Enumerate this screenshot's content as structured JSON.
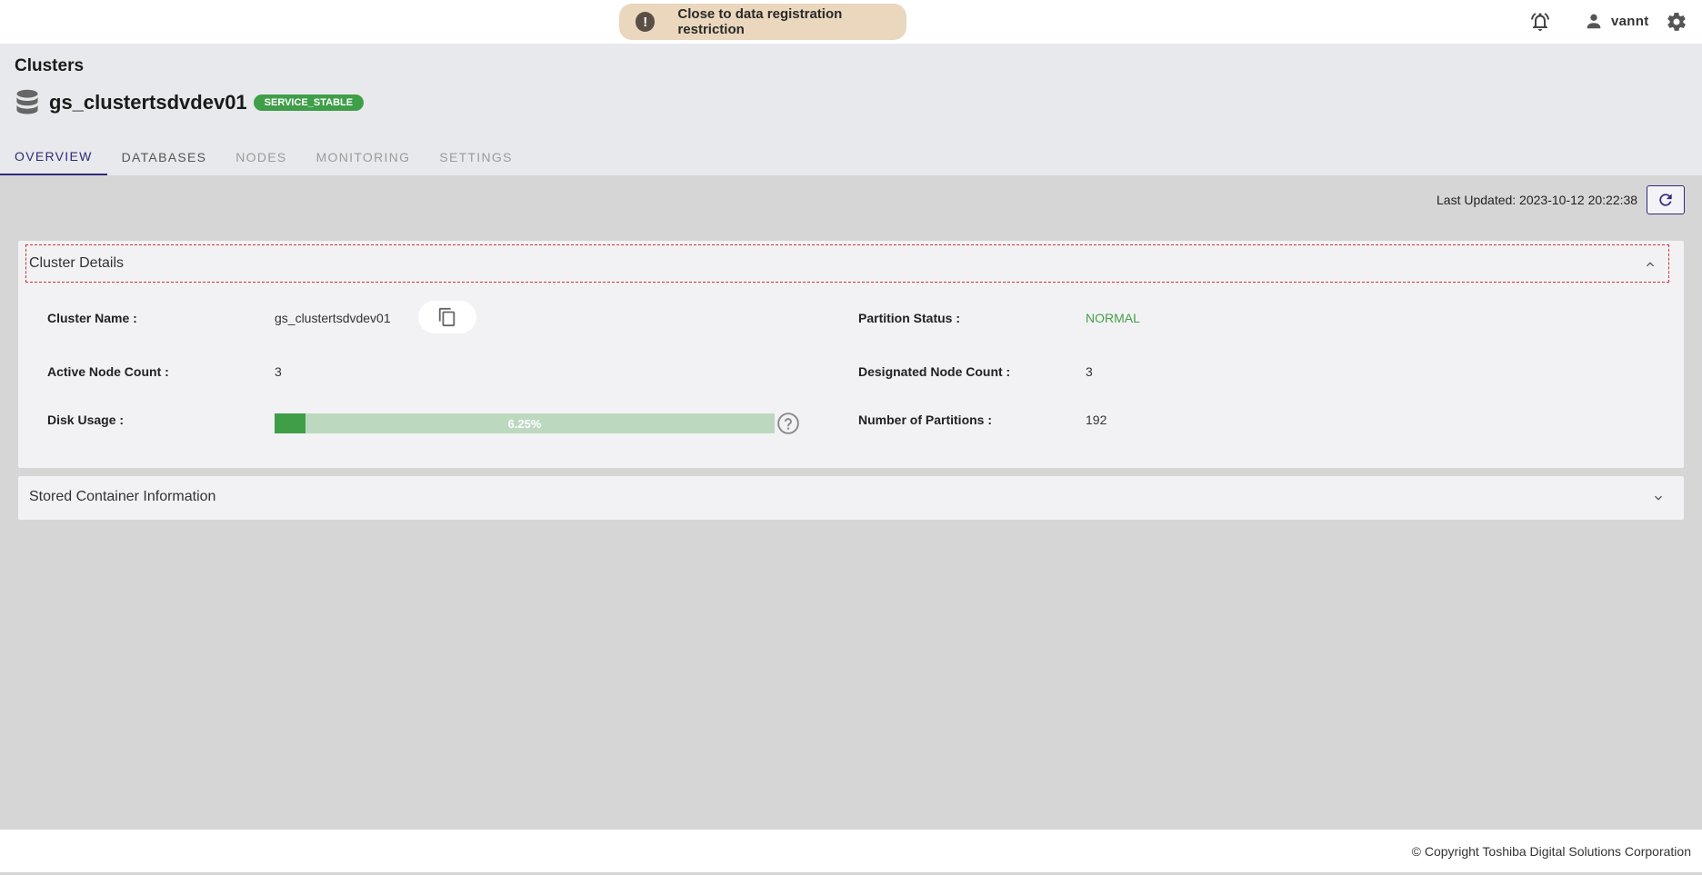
{
  "notification": {
    "text": "Close to data registration restriction"
  },
  "user": {
    "name": "vannt"
  },
  "header": {
    "title": "Clusters",
    "cluster_name": "gs_clustertsdvdev01",
    "status_badge": "SERVICE_STABLE"
  },
  "tabs": [
    {
      "label": "OVERVIEW"
    },
    {
      "label": "DATABASES"
    },
    {
      "label": "NODES"
    },
    {
      "label": "MONITORING"
    },
    {
      "label": "SETTINGS"
    }
  ],
  "last_updated": "Last Updated: 2023-10-12 20:22:38",
  "cluster_details": {
    "title": "Cluster Details",
    "cluster_name_label": "Cluster Name :",
    "cluster_name_value": "gs_clustertsdvdev01",
    "active_node_label": "Active Node Count :",
    "active_node_value": "3",
    "disk_usage_label": "Disk Usage :",
    "disk_usage_text": "6.25%",
    "disk_usage_fraction": 0.0625,
    "partition_status_label": "Partition Status :",
    "partition_status_value": "NORMAL",
    "designated_node_label": "Designated Node Count :",
    "designated_node_value": "3",
    "partitions_label": "Number of Partitions :",
    "partitions_value": "192"
  },
  "stored_container": {
    "title": "Stored Container Information"
  },
  "footer": {
    "text": "© Copyright Toshiba Digital Solutions Corporation"
  },
  "colors": {
    "accent": "#2e2a7a",
    "success": "#3f9e48",
    "warning_bg": "#ead7bd",
    "highlight": "#d32f2f"
  }
}
